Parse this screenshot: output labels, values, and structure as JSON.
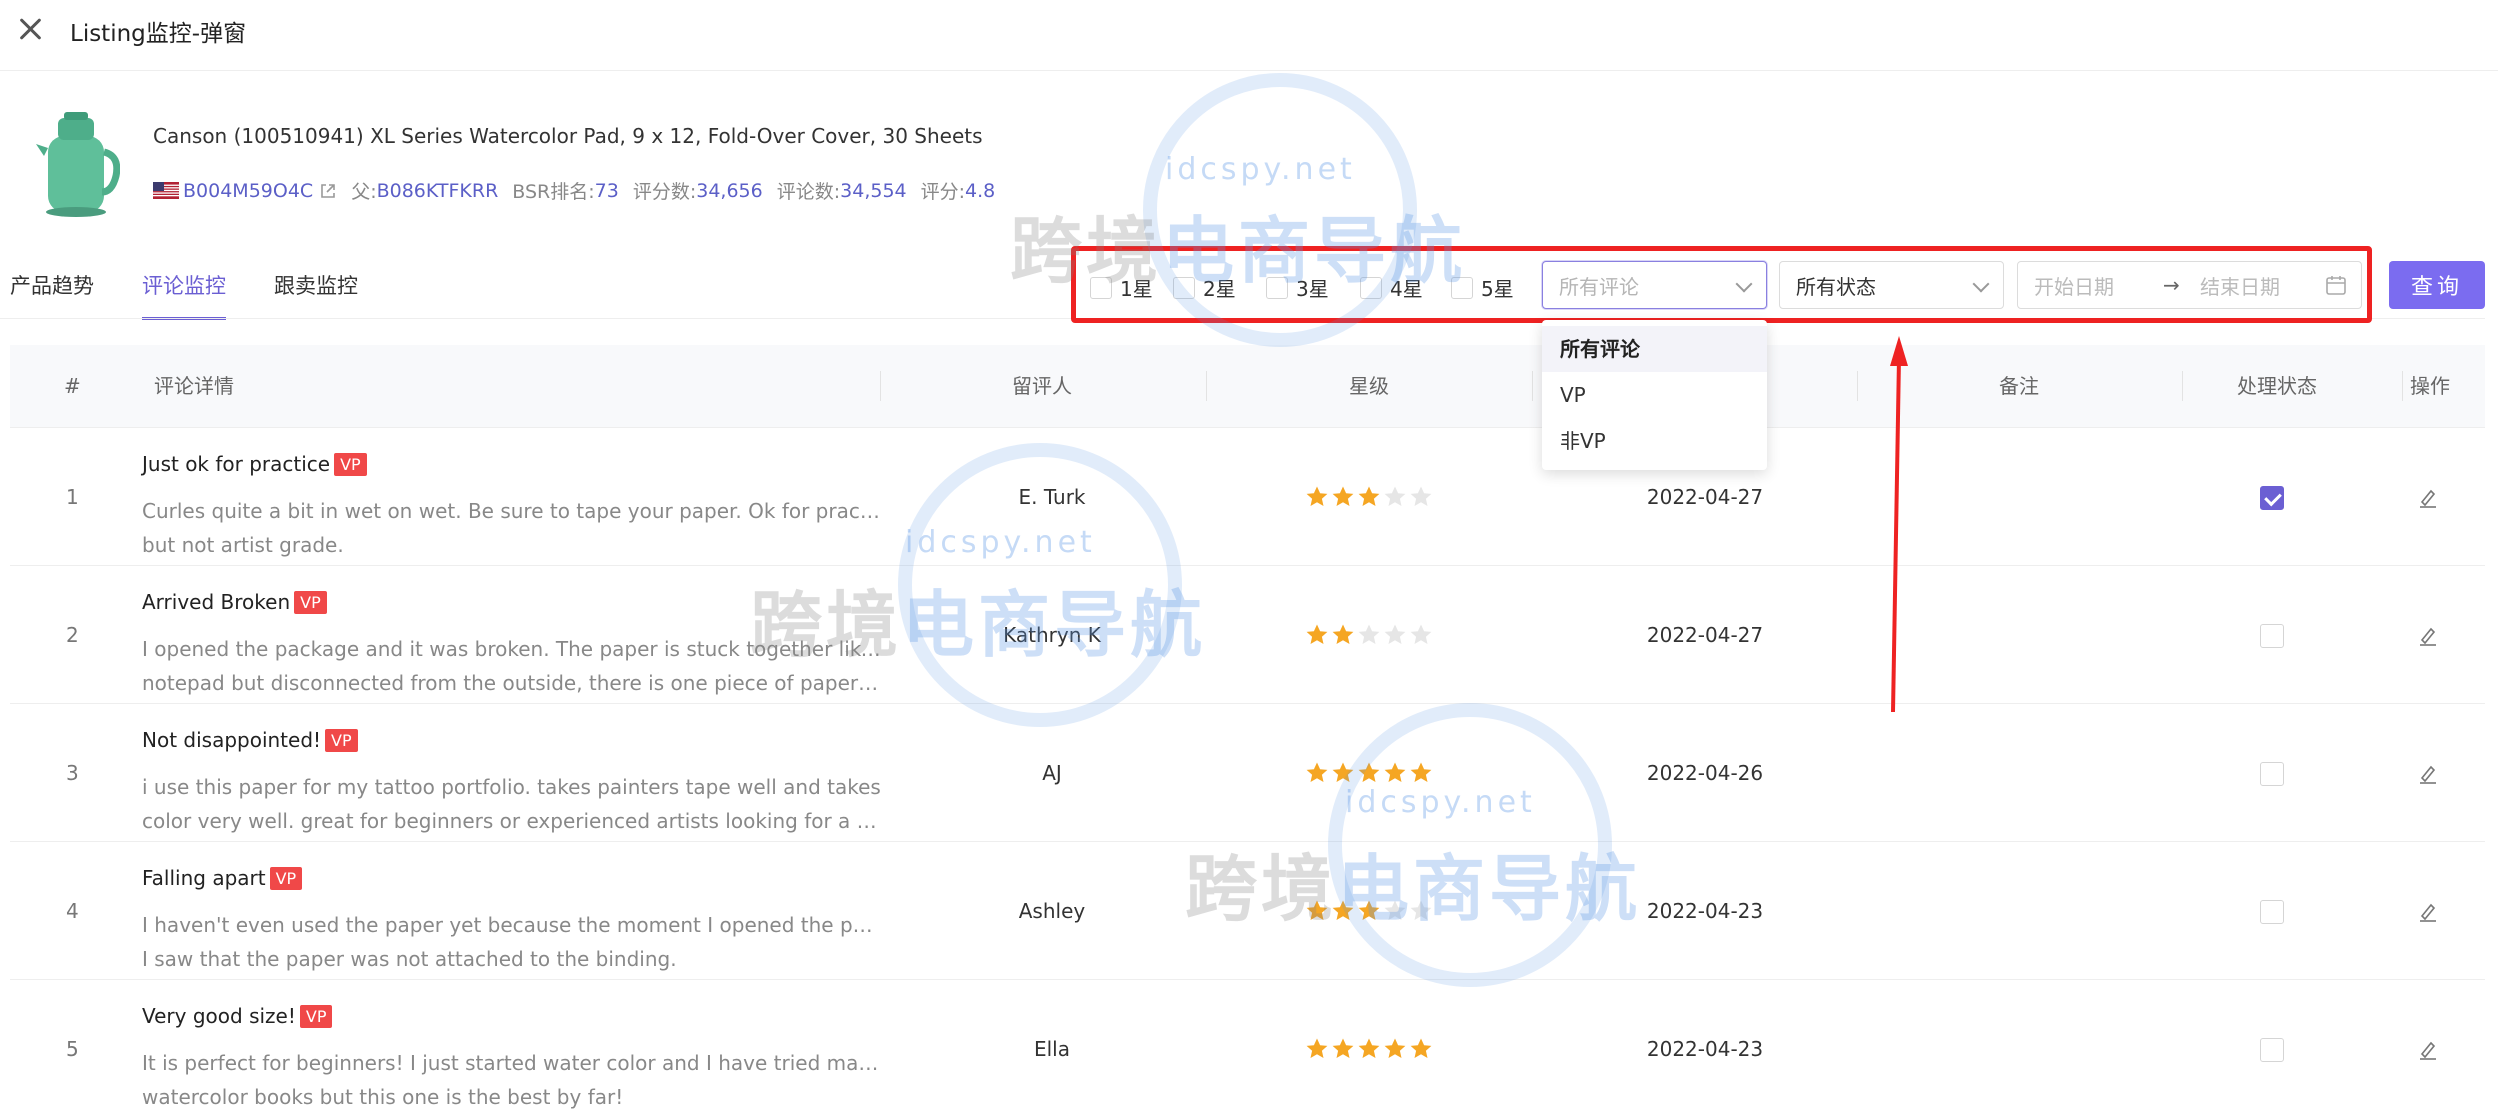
{
  "header": {
    "title": "Listing监控-弹窗"
  },
  "product": {
    "title": "Canson (100510941) XL Series Watercolor Pad, 9 x 12, Fold-Over Cover, 30 Sheets",
    "asin": "B004M59O4C",
    "parent_label": "父:",
    "parent_asin": "B086KTFKRR",
    "bsr_label": "BSR排名:",
    "bsr_value": "73",
    "ratings_label": "评分数:",
    "ratings_value": "34,656",
    "reviews_label": "评论数:",
    "reviews_value": "34,554",
    "score_label": "评分:",
    "score_value": "4.8"
  },
  "tabs": [
    {
      "label": "产品趋势",
      "active": false
    },
    {
      "label": "评论监控",
      "active": true
    },
    {
      "label": "跟卖监控",
      "active": false
    }
  ],
  "filters": {
    "stars": [
      "1星",
      "2星",
      "3星",
      "4星",
      "5星"
    ],
    "review_select_placeholder": "所有评论",
    "status_select_value": "所有状态",
    "start_date_placeholder": "开始日期",
    "range_arrow": "→",
    "end_date_placeholder": "结束日期",
    "query_button": "查询"
  },
  "dropdown": {
    "options": [
      "所有评论",
      "VP",
      "非VP"
    ],
    "selected_index": 0
  },
  "table": {
    "headers": [
      "#",
      "评论详情",
      "留评人",
      "星级",
      "",
      "备注",
      "处理状态",
      "操作"
    ],
    "rows": [
      {
        "index": "1",
        "title": "Just ok for practice",
        "badge": "VP",
        "body": [
          "Curles quite a bit in wet on wet. Be sure to tape your paper. Ok for practice,",
          "but not artist grade."
        ],
        "reviewer": "E. Turk",
        "stars": 3,
        "date": "2022-04-27",
        "processed": true
      },
      {
        "index": "2",
        "title": "Arrived Broken",
        "badge": "VP",
        "body": [
          "I opened the package and it was broken. The paper is stuck together like a",
          "notepad but disconnected from the outside, there is one piece of paper still..."
        ],
        "reviewer": "Kathryn K",
        "stars": 2,
        "date": "2022-04-27",
        "processed": false
      },
      {
        "index": "3",
        "title": "Not disappointed!",
        "badge": "VP",
        "body": [
          "i use this paper for my tattoo portfolio. takes painters tape well and takes",
          "color very well. great for beginners or experienced artists looking for a deal."
        ],
        "reviewer": "AJ",
        "stars": 5,
        "date": "2022-04-26",
        "processed": false
      },
      {
        "index": "4",
        "title": "Falling apart",
        "badge": "VP",
        "body": [
          "I haven't even used the paper yet because the moment I opened the package",
          "I saw that the paper was not attached to the binding."
        ],
        "reviewer": "Ashley",
        "stars": 3,
        "date": "2022-04-23",
        "processed": false
      },
      {
        "index": "5",
        "title": "Very good size!",
        "badge": "VP",
        "body": [
          "It is perfect for beginners! I just started water color and I have tried many",
          "watercolor books but this one is the best by far!"
        ],
        "reviewer": "Ella",
        "stars": 5,
        "date": "2022-04-23",
        "processed": false
      }
    ]
  },
  "watermark": {
    "main_a": "跨境",
    "main_b": "电商导航",
    "sub": "idcspy.net"
  },
  "colors": {
    "accent": "#6b5fd3",
    "star": "#f5a623",
    "badge": "#f04848",
    "annotation": "#ee2222"
  },
  "icons": [
    "close-icon",
    "external-link-icon",
    "us-flag-icon",
    "chevron-down-icon",
    "calendar-icon",
    "star-icon",
    "edit-icon",
    "checkbox-icon"
  ]
}
